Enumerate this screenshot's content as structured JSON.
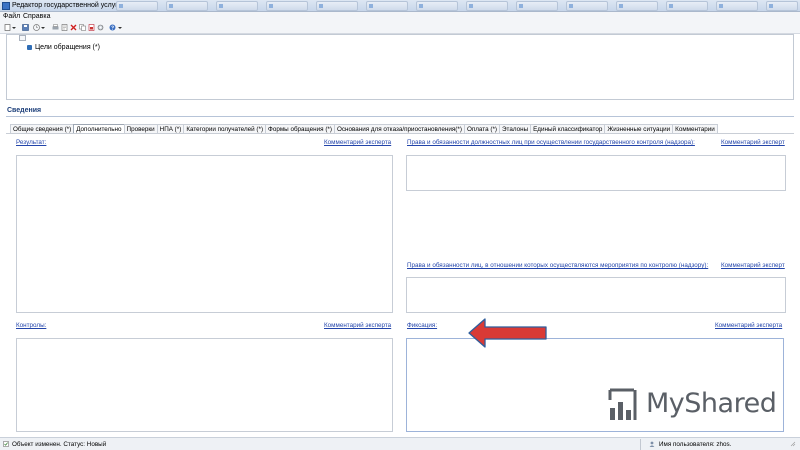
{
  "window": {
    "title": "Редактор государственной услуги",
    "background_tabs": [
      "",
      "",
      "",
      "",
      "",
      "",
      "",
      "",
      "",
      "",
      "",
      "",
      "",
      "",
      ""
    ]
  },
  "menu": {
    "file": "Файл",
    "help": "Справка"
  },
  "tree": {
    "item_label": "Цели обращения (*)"
  },
  "section": {
    "title": "Сведения"
  },
  "tabs": [
    "Общие сведения (*)",
    "Дополнительно",
    "Проверки",
    "НПА (*)",
    "Категории получателей (*)",
    "Формы обращения (*)",
    "Основания для отказа/приостановления(*)",
    "Оплата (*)",
    "Эталоны",
    "Единый классификатор",
    "Жизненные ситуации",
    "Комментарии"
  ],
  "active_tab": "Дополнительно",
  "fields": {
    "result": {
      "label": "Результат:",
      "comment": "Комментарий эксперта"
    },
    "official_rights": {
      "label": "Права и обязанности должностных лиц при осуществлении государственного контроля (надзора):",
      "comment": "Комментарий эксперт"
    },
    "persons_rights": {
      "label": "Права и обязанности лиц, в отношении которых осуществляются мероприятия по контролю (надзору):",
      "comment": "Комментарий эксперт"
    },
    "controls": {
      "label": "Контролы:",
      "comment": "Комментарий эксперта"
    },
    "fixation": {
      "label": "Фиксация:",
      "comment": "Комментарий эксперта"
    }
  },
  "status": {
    "left": "Объект изменен. Статус: Новый",
    "user": "Имя пользователя: zhos."
  },
  "watermark": {
    "text": "MyShared"
  },
  "colors": {
    "arrow": "#d93a36",
    "arrow_outline": "#2e5d9c",
    "link": "#2244aa"
  }
}
